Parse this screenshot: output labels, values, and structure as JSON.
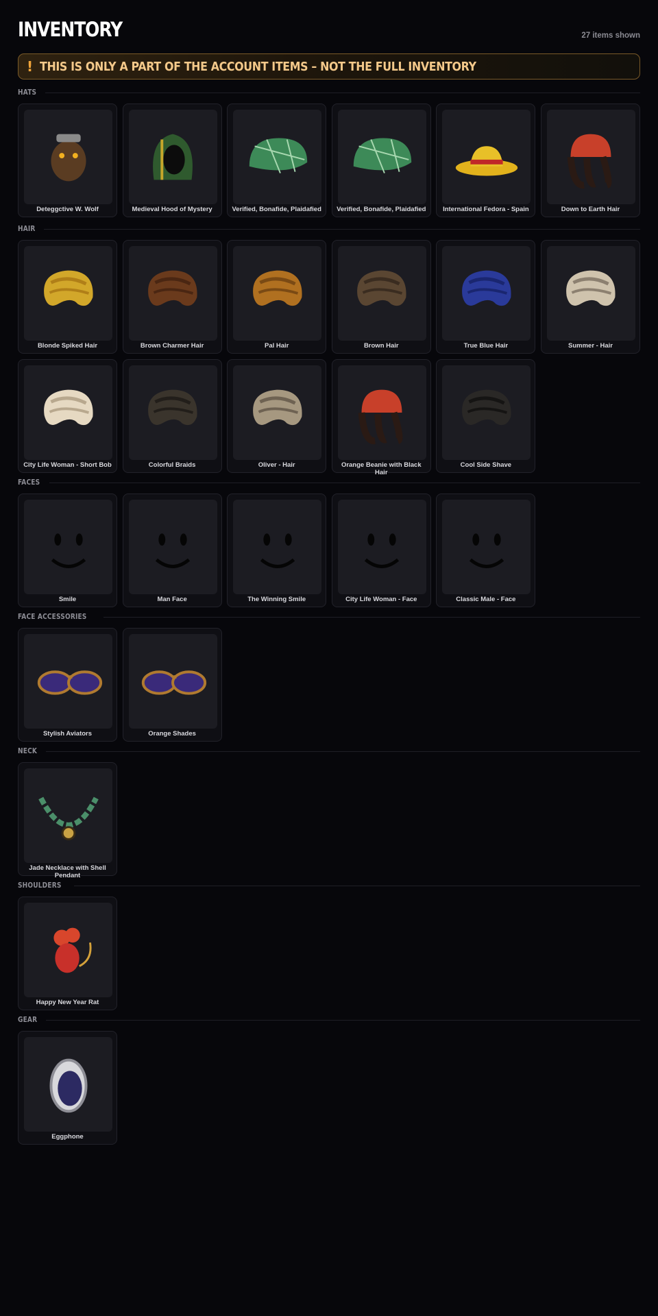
{
  "header": {
    "title": "INVENTORY",
    "count": "27 items shown"
  },
  "banner": {
    "icon": "!",
    "text": "THIS IS ONLY A PART OF THE ACCOUNT ITEMS – NOT THE FULL INVENTORY"
  },
  "sections": [
    {
      "title": "HATS",
      "items": [
        {
          "name": "Deteggctive W. Wolf",
          "icon": "wolf-hat-icon"
        },
        {
          "name": "Medieval Hood of Mystery",
          "icon": "hood-icon"
        },
        {
          "name": "Verified, Bonafide, Plaidafied",
          "icon": "plaid-cap-icon"
        },
        {
          "name": "Verified, Bonafide, Plaidafied",
          "icon": "plaid-cap-icon"
        },
        {
          "name": "International Fedora - Spain",
          "icon": "fedora-icon"
        },
        {
          "name": "Down to Earth Hair",
          "icon": "beanie-hair-icon"
        }
      ]
    },
    {
      "title": "HAIR",
      "items": [
        {
          "name": "Blonde Spiked Hair",
          "icon": "hair-icon"
        },
        {
          "name": "Brown Charmer Hair",
          "icon": "hair-icon"
        },
        {
          "name": "Pal Hair",
          "icon": "hair-icon"
        },
        {
          "name": "Brown Hair",
          "icon": "hair-icon"
        },
        {
          "name": "True Blue Hair",
          "icon": "hair-icon"
        },
        {
          "name": "Summer - Hair",
          "icon": "hair-icon"
        },
        {
          "name": "City Life Woman - Short Bob",
          "icon": "hair-icon"
        },
        {
          "name": "Colorful Braids",
          "icon": "hair-icon"
        },
        {
          "name": "Oliver - Hair",
          "icon": "hair-icon"
        },
        {
          "name": "Orange Beanie with Black Hair",
          "icon": "beanie-hair-icon"
        },
        {
          "name": "Cool Side Shave",
          "icon": "hair-icon"
        }
      ]
    },
    {
      "title": "FACES",
      "items": [
        {
          "name": "Smile",
          "icon": "face-icon"
        },
        {
          "name": "Man Face",
          "icon": "face-icon"
        },
        {
          "name": "The Winning Smile",
          "icon": "face-icon"
        },
        {
          "name": "City Life Woman - Face",
          "icon": "face-icon"
        },
        {
          "name": "Classic Male - Face",
          "icon": "face-icon"
        }
      ]
    },
    {
      "title": "FACE ACCESSORIES",
      "items": [
        {
          "name": "Stylish Aviators",
          "icon": "sunglasses-icon"
        },
        {
          "name": "Orange Shades",
          "icon": "sunglasses-icon"
        }
      ]
    },
    {
      "title": "NECK",
      "items": [
        {
          "name": "Jade Necklace with Shell Pendant",
          "icon": "necklace-icon"
        }
      ]
    },
    {
      "title": "SHOULDERS",
      "items": [
        {
          "name": "Happy New Year Rat",
          "icon": "rat-icon"
        }
      ]
    },
    {
      "title": "GEAR",
      "items": [
        {
          "name": "Eggphone",
          "icon": "eggphone-icon"
        }
      ]
    }
  ],
  "colors": {
    "background": "#07070b",
    "card": "#0f0f14",
    "thumb": "#1c1c22",
    "banner_border": "#7a5a28",
    "banner_text": "#f4c98a",
    "accent": "#f0a43a"
  }
}
